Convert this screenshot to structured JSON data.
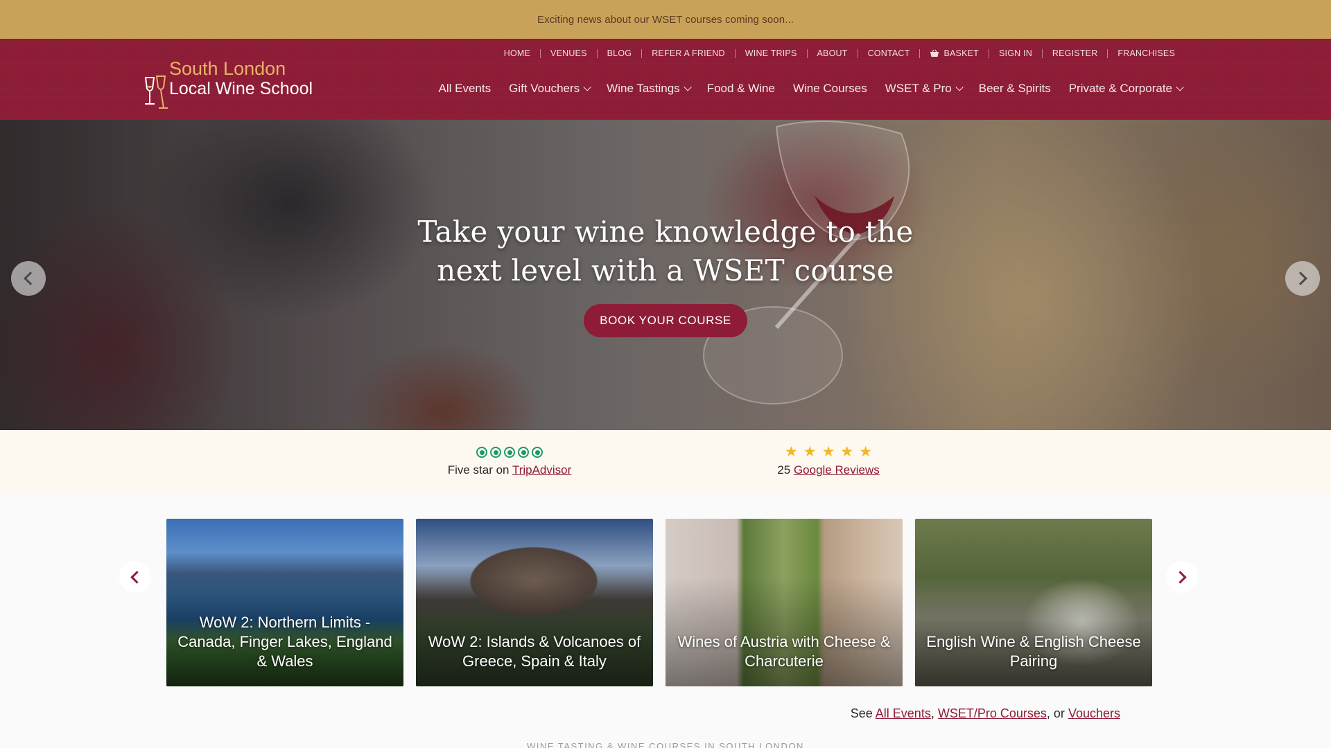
{
  "announcement": "Exciting news about our WSET courses coming soon...",
  "logo": {
    "line1": "South London",
    "line2": "Local Wine School"
  },
  "top_nav": [
    "HOME",
    "VENUES",
    "BLOG",
    "REFER A FRIEND",
    "WINE TRIPS",
    "ABOUT",
    "CONTACT",
    "BASKET",
    "SIGN IN",
    "REGISTER",
    "FRANCHISES"
  ],
  "main_nav": [
    {
      "label": "All Events",
      "dropdown": false
    },
    {
      "label": "Gift Vouchers",
      "dropdown": true
    },
    {
      "label": "Wine Tastings",
      "dropdown": true
    },
    {
      "label": "Food & Wine",
      "dropdown": false
    },
    {
      "label": "Wine Courses",
      "dropdown": false
    },
    {
      "label": "WSET & Pro",
      "dropdown": true
    },
    {
      "label": "Beer & Spirits",
      "dropdown": false
    },
    {
      "label": "Private & Corporate",
      "dropdown": true
    }
  ],
  "hero": {
    "title_line1": "Take your wine knowledge to the",
    "title_line2": "next level with a WSET course",
    "button": "BOOK YOUR COURSE"
  },
  "reviews": {
    "tripadvisor": {
      "prefix": "Five star on",
      "link": "TripAdvisor",
      "rating": 5
    },
    "google": {
      "prefix": "25",
      "link": "Google Reviews",
      "rating": 5
    }
  },
  "cards": [
    {
      "title": "WoW 2: Northern Limits - Canada, Finger Lakes, England & Wales"
    },
    {
      "title": "WoW 2: Islands & Volcanoes of Greece, Spain & Italy"
    },
    {
      "title": "Wines of Austria with Cheese & Charcuterie"
    },
    {
      "title": "English Wine & English Cheese Pairing"
    }
  ],
  "see_line": {
    "prefix": "See",
    "link1": "All Events",
    "sep1": ",",
    "link2": "WSET/Pro Courses",
    "sep2": ", or",
    "link3": "Vouchers"
  },
  "footer_subtitle": "Wine Tasting & Wine Courses in South London",
  "colors": {
    "brand": "#8e1c36",
    "announce": "#c9a25a",
    "accent_gold": "#e7b368",
    "tripadvisor": "#1d9a6c",
    "star": "#f2b722"
  }
}
